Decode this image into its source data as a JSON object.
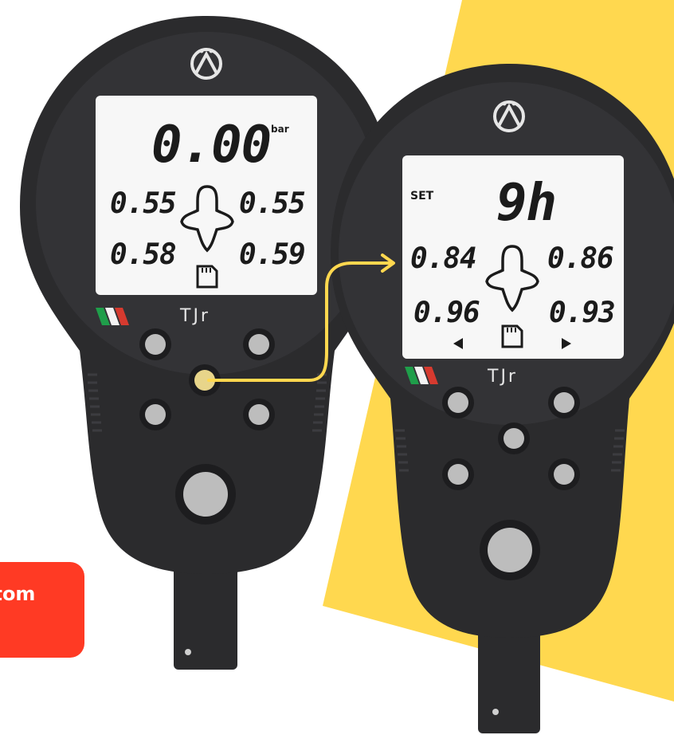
{
  "colors": {
    "accent_yellow": "#ffd84f",
    "device_body": "#2b2b2d",
    "lcd_background": "#f7f7f7",
    "callout_red": "#ff3a24",
    "button_grey": "#bdbdbd",
    "highlight_button": "#e8d58a"
  },
  "callout": {
    "text": "ttom"
  },
  "device_left": {
    "brand_label": "TJr",
    "main_value": "0.00",
    "unit": "bar",
    "front_left": "0.55",
    "front_right": "0.55",
    "rear_left": "0.58",
    "rear_right": "0.59",
    "icons": [
      "logo-icon",
      "kart-icon",
      "sd-card-icon",
      "italian-flag-icon"
    ]
  },
  "device_right": {
    "brand_label": "TJr",
    "mode_label": "SET",
    "main_value": "9h",
    "front_left": "0.84",
    "front_right": "0.86",
    "rear_left": "0.96",
    "rear_right": "0.93",
    "icons": [
      "logo-icon",
      "kart-icon",
      "sd-card-icon",
      "arrow-left-icon",
      "arrow-right-icon",
      "italian-flag-icon"
    ]
  },
  "connector": {
    "icon": "arrow-connector"
  }
}
